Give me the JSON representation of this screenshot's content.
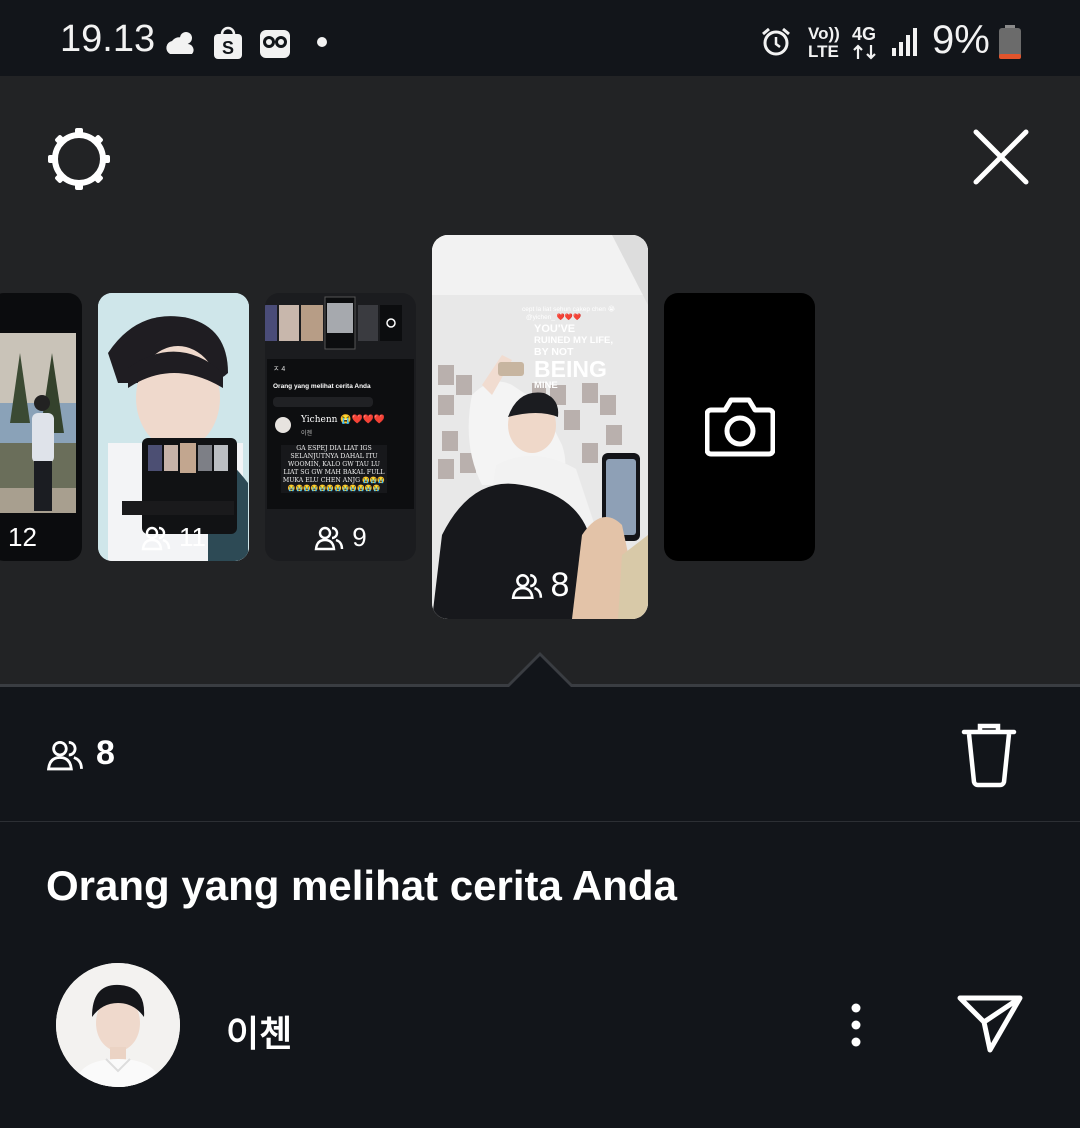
{
  "status_bar": {
    "time": "19.13",
    "network_top": "Vo))",
    "network_bottom": "LTE",
    "network_type": "4G",
    "battery": "9%",
    "icons": [
      "weather-cloud-sun-icon",
      "shopee-bag-icon",
      "owl-app-icon",
      "notification-dot-icon",
      "alarm-icon",
      "signal-icon",
      "battery-icon"
    ]
  },
  "toolbar": {
    "settings_icon": "gear-icon",
    "close_icon": "close-icon"
  },
  "stories": [
    {
      "count": "12",
      "kind": "photo-outdoor"
    },
    {
      "count": "11",
      "kind": "photo-portrait"
    },
    {
      "count": "9",
      "kind": "screenshot"
    },
    {
      "count": "8",
      "kind": "photo-mirror-selfie",
      "selected": true,
      "overlay_line1": "cept la liat sehun cakep chen 😭",
      "overlay_tag": "@yichen_ ❤️❤️❤️",
      "overlay_big1": "YOU'VE",
      "overlay_big2": "RUINED MY LIFE,",
      "overlay_big3": "BY NOT",
      "overlay_big4": "BEING",
      "overlay_big5": "MINE"
    },
    {
      "kind": "add-camera"
    }
  ],
  "thumb3": {
    "header_small": "ㅈ 4",
    "title": "Orang yang melihat cerita Anda",
    "name": "Yichenn 😭❤️❤️❤️",
    "sub": "이첸",
    "caption": "GA ESPEJ DIA LIAT IGS SELANJUTNYA DAHAL ITU WOOMIN, KALO GW TAU LU LIAT SG GW MAH BAKAL FULL MUKA ELU CHEN ANJG 😭😭😭😭😭😭😭😭😭😭😭😭😭😭😭"
  },
  "selected": {
    "viewer_count": "8",
    "delete_icon": "trash-icon"
  },
  "viewers_section": {
    "title": "Orang yang melihat cerita Anda",
    "viewers": [
      {
        "name": "이첸",
        "more_icon": "more-vertical-icon",
        "send_icon": "send-icon"
      }
    ]
  },
  "colors": {
    "background": "#12151a",
    "viewer_area": "#222325",
    "text": "#ffffff"
  }
}
